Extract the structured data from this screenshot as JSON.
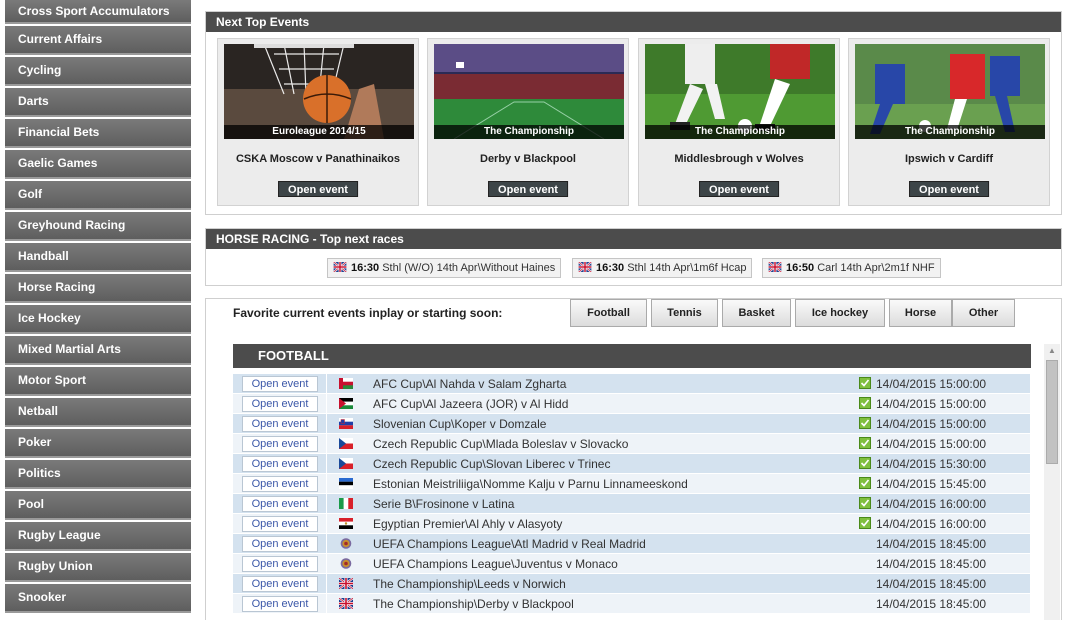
{
  "sidebar": {
    "items": [
      "Cross Sport Accumulators",
      "Current Affairs",
      "Cycling",
      "Darts",
      "Financial Bets",
      "Gaelic Games",
      "Golf",
      "Greyhound Racing",
      "Handball",
      "Horse Racing",
      "Ice Hockey",
      "Mixed Martial Arts",
      "Motor Sport",
      "Netball",
      "Poker",
      "Politics",
      "Pool",
      "Rugby League",
      "Rugby Union",
      "Snooker"
    ]
  },
  "top_events": {
    "title": "Next Top Events",
    "cards": [
      {
        "caption": "Euroleague 2014/15",
        "title": "CSKA Moscow v Panathinaikos",
        "button": "Open event",
        "image": "basketball-photo"
      },
      {
        "caption": "The Championship",
        "title": "Derby v Blackpool",
        "button": "Open event",
        "image": "stadium-photo"
      },
      {
        "caption": "The Championship",
        "title": "Middlesbrough v Wolves",
        "button": "Open event",
        "image": "football-legs-photo"
      },
      {
        "caption": "The Championship",
        "title": "Ipswich v Cardiff",
        "button": "Open event",
        "image": "football-players-photo"
      }
    ]
  },
  "horse_racing": {
    "title": "HORSE RACING - Top next races",
    "races": [
      {
        "time": "16:30",
        "desc": "Sthl (W/O) 14th Apr\\Without Haines"
      },
      {
        "time": "16:30",
        "desc": "Sthl 14th Apr\\1m6f Hcap"
      },
      {
        "time": "16:50",
        "desc": "Carl 14th Apr\\2m1f NHF"
      }
    ]
  },
  "favorites": {
    "label": "Favorite current events inplay or starting soon:",
    "tabs": [
      "Football",
      "Tennis",
      "Basket",
      "Ice hockey",
      "Horse",
      "Other"
    ],
    "section_title": "FOOTBALL",
    "open_label": "Open event",
    "rows": [
      {
        "flag": "oman",
        "name": "AFC Cup\\Al Nahda v Salam Zgharta",
        "live": true,
        "time": "14/04/2015 15:00:00"
      },
      {
        "flag": "jordan",
        "name": "AFC Cup\\Al Jazeera (JOR) v Al Hidd",
        "live": true,
        "time": "14/04/2015 15:00:00"
      },
      {
        "flag": "slovenia",
        "name": "Slovenian Cup\\Koper v Domzale",
        "live": true,
        "time": "14/04/2015 15:00:00"
      },
      {
        "flag": "czech",
        "name": "Czech Republic Cup\\Mlada Boleslav v Slovacko",
        "live": true,
        "time": "14/04/2015 15:00:00"
      },
      {
        "flag": "czech",
        "name": "Czech Republic Cup\\Slovan Liberec v Trinec",
        "live": true,
        "time": "14/04/2015 15:30:00"
      },
      {
        "flag": "estonia",
        "name": "Estonian Meistriliiga\\Nomme Kalju v Parnu Linnameeskond",
        "live": true,
        "time": "14/04/2015 15:45:00"
      },
      {
        "flag": "italy",
        "name": "Serie B\\Frosinone v Latina",
        "live": true,
        "time": "14/04/2015 16:00:00"
      },
      {
        "flag": "egypt",
        "name": "Egyptian Premier\\Al Ahly v Alasyoty",
        "live": true,
        "time": "14/04/2015 16:00:00"
      },
      {
        "flag": "europe-globe",
        "name": "UEFA Champions League\\Atl Madrid v Real Madrid",
        "live": false,
        "time": "14/04/2015 18:45:00"
      },
      {
        "flag": "europe-globe",
        "name": "UEFA Champions League\\Juventus v Monaco",
        "live": false,
        "time": "14/04/2015 18:45:00"
      },
      {
        "flag": "uk",
        "name": "The Championship\\Leeds v Norwich",
        "live": false,
        "time": "14/04/2015 18:45:00"
      },
      {
        "flag": "uk",
        "name": "The Championship\\Derby v Blackpool",
        "live": false,
        "time": "14/04/2015 18:45:00"
      }
    ]
  },
  "colors": {
    "sidebar_bg": "#6a6a6a",
    "header_bg": "#4c4c4c",
    "row_alt": "#d4e2ef",
    "row_normal": "#eef3f8",
    "link_blue": "#3b57a8",
    "live_green": "#7fbf3f"
  }
}
